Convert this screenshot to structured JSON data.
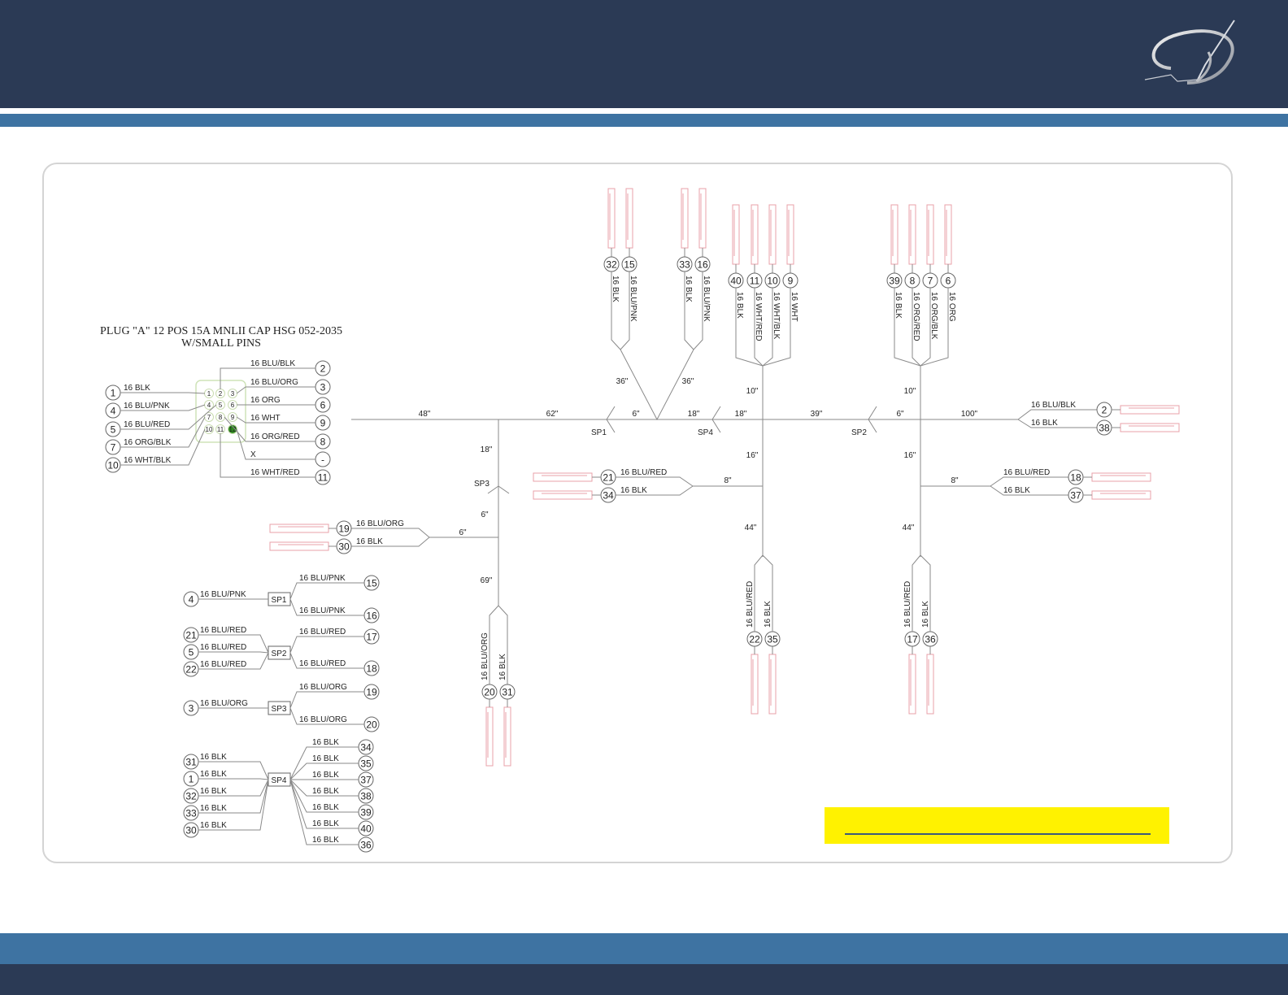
{
  "colors": {
    "header": "#2b3a55",
    "band": "#3e73a2",
    "connector": "#e8a0a8",
    "highlight_cavity": "#2e8b1e",
    "note": "#fff200"
  },
  "logo": {
    "icon": "brand-script-logo"
  },
  "plug": {
    "title_line1": "PLUG \"A\" 12 POS 15A MNLII CAP HSG 052-2035",
    "title_line2": "W/SMALL PINS",
    "cavities": [
      "1",
      "2",
      "3",
      "4",
      "5",
      "6",
      "7",
      "8",
      "9",
      "10",
      "11",
      "12"
    ],
    "highlight_cavity": "12",
    "left": [
      {
        "pin": "1",
        "wire": "16 BLK",
        "cavity": "1"
      },
      {
        "pin": "4",
        "wire": "16 BLU/PNK",
        "cavity": "4"
      },
      {
        "pin": "5",
        "wire": "16 BLU/RED",
        "cavity": "5"
      },
      {
        "pin": "7",
        "wire": "16 ORG/BLK",
        "cavity": "7"
      },
      {
        "pin": "10",
        "wire": "16 WHT/BLK",
        "cavity": "10"
      }
    ],
    "right": [
      {
        "pin": "2",
        "wire": "16 BLU/BLK",
        "cavity": "2"
      },
      {
        "pin": "3",
        "wire": "16 BLU/ORG",
        "cavity": "3"
      },
      {
        "pin": "6",
        "wire": "16 ORG",
        "cavity": "6"
      },
      {
        "pin": "9",
        "wire": "16 WHT",
        "cavity": "9"
      },
      {
        "pin": "8",
        "wire": "16 ORG/RED",
        "cavity": "8"
      },
      {
        "pin": "-",
        "wire": "X",
        "cavity": "12"
      },
      {
        "pin": "11",
        "wire": "16 WHT/RED",
        "cavity": "11"
      }
    ]
  },
  "lengths": [
    "48\"",
    "62\"",
    "6\"",
    "18\"",
    "18\"",
    "39\"",
    "6\"",
    "100\"",
    "36\"",
    "36\"",
    "10\"",
    "10\"",
    "16\"",
    "16\"",
    "8\"",
    "8\"",
    "44\"",
    "44\"",
    "18\"",
    "6\"",
    "6\"",
    "69\""
  ],
  "splice_marks": [
    "SP1",
    "SP4",
    "SP2",
    "SP3"
  ],
  "breakouts": {
    "top_a": [
      {
        "pin": "32",
        "wire": "16 BLK"
      },
      {
        "pin": "15",
        "wire": "16 BLU/PNK"
      }
    ],
    "top_b": [
      {
        "pin": "33",
        "wire": "16 BLK"
      },
      {
        "pin": "16",
        "wire": "16 BLU/PNK"
      }
    ],
    "top_c": [
      {
        "pin": "40",
        "wire": "16 BLK"
      },
      {
        "pin": "11",
        "wire": "16 WHT/RED"
      },
      {
        "pin": "10",
        "wire": "16 WHT/BLK"
      },
      {
        "pin": "9",
        "wire": "16 WHT"
      }
    ],
    "top_d": [
      {
        "pin": "39",
        "wire": "16 BLK"
      },
      {
        "pin": "8",
        "wire": "16 ORG/RED"
      },
      {
        "pin": "7",
        "wire": "16 ORG/BLK"
      },
      {
        "pin": "6",
        "wire": "16 ORG"
      }
    ],
    "right_e": [
      {
        "pin": "2",
        "wire": "16 BLU/BLK"
      },
      {
        "pin": "38",
        "wire": "16 BLK"
      }
    ],
    "mid_f": [
      {
        "pin": "21",
        "wire": "16 BLU/RED"
      },
      {
        "pin": "34",
        "wire": "16 BLK"
      }
    ],
    "right_g": [
      {
        "pin": "18",
        "wire": "16 BLU/RED"
      },
      {
        "pin": "37",
        "wire": "16 BLK"
      }
    ],
    "left_h": [
      {
        "pin": "19",
        "wire": "16 BLU/ORG"
      },
      {
        "pin": "30",
        "wire": "16 BLK"
      }
    ],
    "bottom_i": [
      {
        "pin": "20",
        "wire": "16 BLU/ORG"
      },
      {
        "pin": "31",
        "wire": "16 BLK"
      }
    ],
    "bottom_j": [
      {
        "pin": "22",
        "wire": "16 BLU/RED"
      },
      {
        "pin": "35",
        "wire": "16 BLK"
      }
    ],
    "bottom_k": [
      {
        "pin": "17",
        "wire": "16 BLU/RED"
      },
      {
        "pin": "36",
        "wire": "16 BLK"
      }
    ]
  },
  "splice_table": [
    {
      "splice": "SP1",
      "inputs": [
        {
          "pin": "4",
          "wire": "16 BLU/PNK"
        }
      ],
      "outputs": [
        {
          "pin": "15",
          "wire": "16 BLU/PNK"
        },
        {
          "pin": "16",
          "wire": "16 BLU/PNK"
        }
      ]
    },
    {
      "splice": "SP2",
      "inputs": [
        {
          "pin": "21",
          "wire": "16 BLU/RED"
        },
        {
          "pin": "5",
          "wire": "16 BLU/RED"
        },
        {
          "pin": "22",
          "wire": "16 BLU/RED"
        }
      ],
      "outputs": [
        {
          "pin": "17",
          "wire": "16 BLU/RED"
        },
        {
          "pin": "18",
          "wire": "16 BLU/RED"
        }
      ]
    },
    {
      "splice": "SP3",
      "inputs": [
        {
          "pin": "3",
          "wire": "16 BLU/ORG"
        }
      ],
      "outputs": [
        {
          "pin": "19",
          "wire": "16 BLU/ORG"
        },
        {
          "pin": "20",
          "wire": "16 BLU/ORG"
        }
      ]
    },
    {
      "splice": "SP4",
      "inputs": [
        {
          "pin": "31",
          "wire": "16 BLK"
        },
        {
          "pin": "1",
          "wire": "16 BLK"
        },
        {
          "pin": "32",
          "wire": "16 BLK"
        },
        {
          "pin": "33",
          "wire": "16 BLK"
        },
        {
          "pin": "30",
          "wire": "16 BLK"
        }
      ],
      "outputs": [
        {
          "pin": "34",
          "wire": "16 BLK"
        },
        {
          "pin": "35",
          "wire": "16 BLK"
        },
        {
          "pin": "37",
          "wire": "16 BLK"
        },
        {
          "pin": "38",
          "wire": "16 BLK"
        },
        {
          "pin": "39",
          "wire": "16 BLK"
        },
        {
          "pin": "40",
          "wire": "16 BLK"
        },
        {
          "pin": "36",
          "wire": "16 BLK"
        }
      ]
    }
  ]
}
